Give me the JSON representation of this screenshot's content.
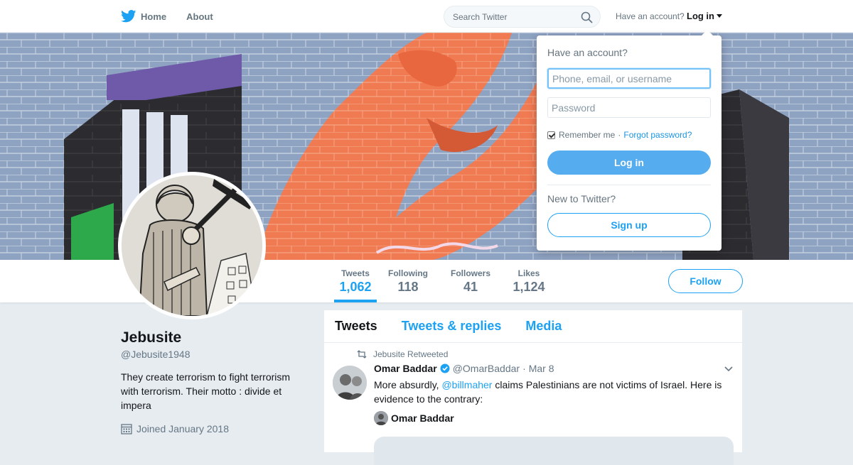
{
  "nav": {
    "home_label": "Home",
    "about_label": "About",
    "search_placeholder": "Search Twitter",
    "have_account": "Have an account?",
    "login_label": "Log in"
  },
  "profile": {
    "name": "Jebusite",
    "handle": "@Jebusite1948",
    "bio": "They create terrorism to fight terrorism with terrorism. Their motto : divide et impera",
    "joined": "Joined January 2018"
  },
  "stats": [
    {
      "label": "Tweets",
      "value": "1,062",
      "active": true
    },
    {
      "label": "Following",
      "value": "118"
    },
    {
      "label": "Followers",
      "value": "41"
    },
    {
      "label": "Likes",
      "value": "1,124"
    }
  ],
  "follow_label": "Follow",
  "timeline": {
    "tabs": [
      "Tweets",
      "Tweets & replies",
      "Media"
    ],
    "tweet": {
      "retweeted_by": "Jebusite Retweeted",
      "author": "Omar Baddar",
      "handle": "@OmarBaddar",
      "separator": "·",
      "date": "Mar 8",
      "text_before": "More absurdly, ",
      "mention": "@billmaher",
      "text_after": " claims Palestinians are not victims of Israel. Here is evidence to the contrary:",
      "quoted_author": "Omar Baddar"
    }
  },
  "login_dropdown": {
    "title": "Have an account?",
    "username_placeholder": "Phone, email, or username",
    "password_placeholder": "Password",
    "remember": "Remember me",
    "separator": "·",
    "forgot": "Forgot password?",
    "login_button": "Log in",
    "new_to_twitter": "New to Twitter?",
    "signup_button": "Sign up"
  },
  "colors": {
    "accent": "#1da1f2",
    "login_button": "#55acee",
    "background": "#e6ecf0"
  },
  "icons": [
    "twitter-bird-icon",
    "search-icon",
    "caret-down-icon",
    "calendar-icon",
    "retweet-icon",
    "verified-badge-icon",
    "chevron-down-icon"
  ]
}
